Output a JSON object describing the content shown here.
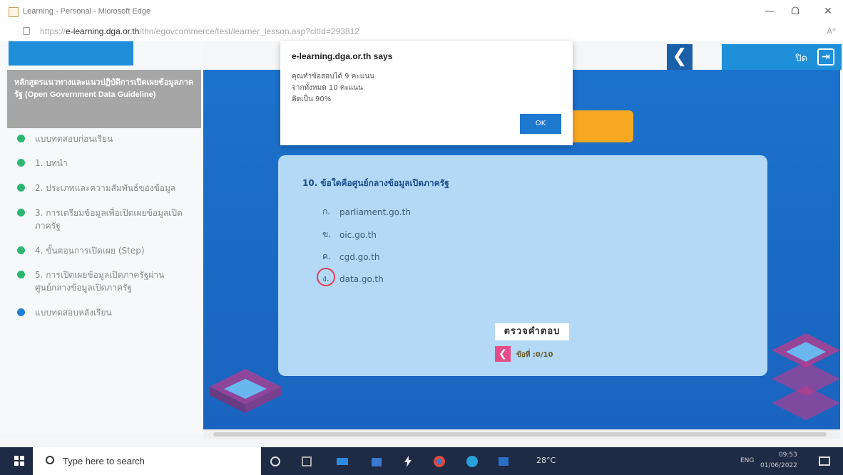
{
  "window": {
    "title": "Learning - Personal - Microsoft Edge",
    "minimize": "—",
    "restore": "ᗝ",
    "close": "✕"
  },
  "address": {
    "url_prefix": "https://",
    "url_host": "e-learning.dga.or.th",
    "url_rest": "/thn/egovcommerce/test/learner_lesson.asp?cltId=293812",
    "read_aloud": "A⁰"
  },
  "sidebar": {
    "course_title": "หลักสูตรแนวทางและแนวปฏิบัติการเปิดเผยข้อมูลภาครัฐ (Open Government Data Guideline)",
    "items": [
      {
        "label": "แบบทดสอบก่อนเรียน",
        "status": "done"
      },
      {
        "label": "1. บทนำ",
        "status": "done"
      },
      {
        "label": "2. ประเภทและความสัมพันธ์ของข้อมูล",
        "status": "done"
      },
      {
        "label": "3. การเตรียมข้อมูลเพื่อเปิดเผยข้อมูลเปิดภาครัฐ",
        "status": "done"
      },
      {
        "label": "4. ขั้นตอนการเปิดเผย (Step)",
        "status": "done"
      },
      {
        "label": "5. การเปิดเผยข้อมูลเปิดภาครัฐผ่านศูนย์กลางข้อมูลเปิดภาครัฐ",
        "status": "done"
      },
      {
        "label": "แบบทดสอบหลังเรียน",
        "status": "current"
      }
    ]
  },
  "nav": {
    "back_icon": "❮",
    "exit_label": "ปิด",
    "exit_icon": "⇥"
  },
  "dialog": {
    "title": "e-learning.dga.or.th says",
    "line1": "คุณทำข้อสอบได้ 9 คะแนน",
    "line2": "จากทั้งหมด 10 คะแนน",
    "line3": "คิดเป็น 90%",
    "ok_label": "OK"
  },
  "quiz": {
    "question": "10. ข้อใดคือศูนย์กลางข้อมูลเปิดภาครัฐ",
    "options": [
      {
        "key": "ก.",
        "text": "parliament.go.th",
        "selected": false
      },
      {
        "key": "ข.",
        "text": "oic.go.th",
        "selected": false
      },
      {
        "key": "ค.",
        "text": "cgd.go.th",
        "selected": false
      },
      {
        "key": "ง.",
        "text": "data.go.th",
        "selected": true
      }
    ],
    "check_label": "ตรวจคำตอบ",
    "prev_icon": "❮",
    "counter": "ข้อที่ :0/10"
  },
  "taskbar": {
    "search_placeholder": "Type here to search",
    "weather": "28°C",
    "lang": "ENG",
    "time": "09:53",
    "date": "01/06/2022"
  },
  "colors": {
    "stage_blue": "#1d6fc6",
    "card_blue": "#b4d9f6",
    "accent_orange": "#f7a823",
    "done_green": "#2bb673",
    "current_blue": "#1f7fd6",
    "pink": "#e74c8a"
  }
}
